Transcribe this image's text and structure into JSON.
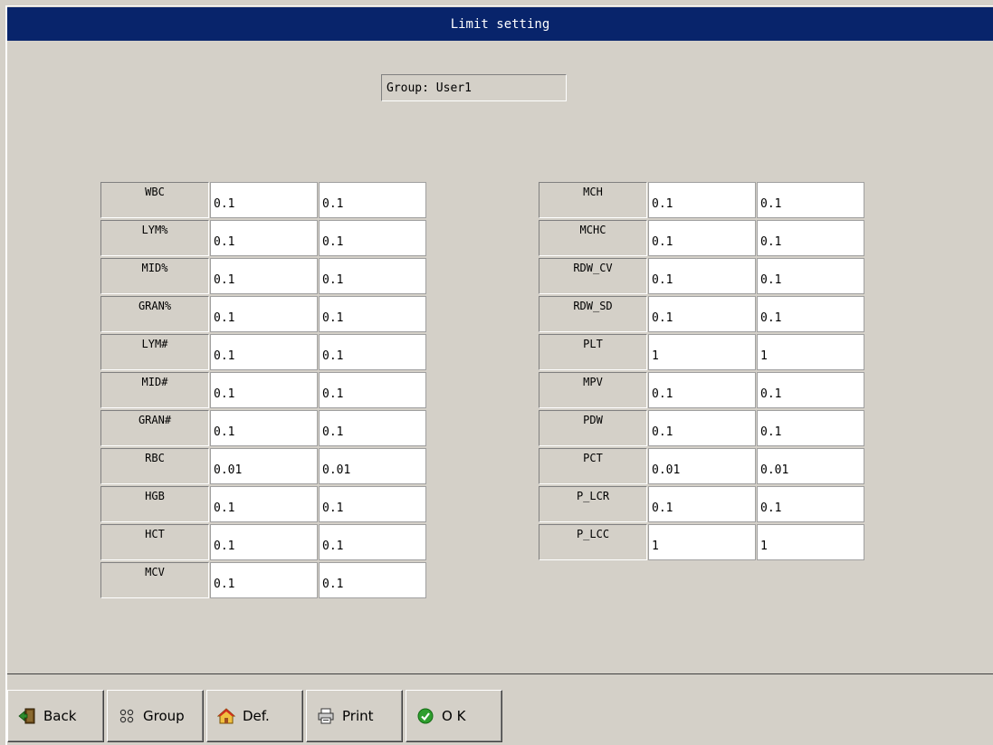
{
  "window": {
    "title": "Limit setting"
  },
  "group": {
    "text": "Group: User1"
  },
  "left_rows": [
    {
      "label": "WBC",
      "v1": "0.1",
      "v2": "0.1"
    },
    {
      "label": "LYM%",
      "v1": "0.1",
      "v2": "0.1"
    },
    {
      "label": "MID%",
      "v1": "0.1",
      "v2": "0.1"
    },
    {
      "label": "GRAN%",
      "v1": "0.1",
      "v2": "0.1"
    },
    {
      "label": "LYM#",
      "v1": "0.1",
      "v2": "0.1"
    },
    {
      "label": "MID#",
      "v1": "0.1",
      "v2": "0.1"
    },
    {
      "label": "GRAN#",
      "v1": "0.1",
      "v2": "0.1"
    },
    {
      "label": "RBC",
      "v1": "0.01",
      "v2": "0.01"
    },
    {
      "label": "HGB",
      "v1": "0.1",
      "v2": "0.1"
    },
    {
      "label": "HCT",
      "v1": "0.1",
      "v2": "0.1"
    },
    {
      "label": "MCV",
      "v1": "0.1",
      "v2": "0.1"
    }
  ],
  "right_rows": [
    {
      "label": "MCH",
      "v1": "0.1",
      "v2": "0.1"
    },
    {
      "label": "MCHC",
      "v1": "0.1",
      "v2": "0.1"
    },
    {
      "label": "RDW_CV",
      "v1": "0.1",
      "v2": "0.1"
    },
    {
      "label": "RDW_SD",
      "v1": "0.1",
      "v2": "0.1"
    },
    {
      "label": "PLT",
      "v1": "1",
      "v2": "1"
    },
    {
      "label": "MPV",
      "v1": "0.1",
      "v2": "0.1"
    },
    {
      "label": "PDW",
      "v1": "0.1",
      "v2": "0.1"
    },
    {
      "label": "PCT",
      "v1": "0.01",
      "v2": "0.01"
    },
    {
      "label": "P_LCR",
      "v1": "0.1",
      "v2": "0.1"
    },
    {
      "label": "P_LCC",
      "v1": "1",
      "v2": "1"
    }
  ],
  "toolbar": {
    "back_label": "Back",
    "back_icon": "exit-door-icon",
    "group_label": "Group",
    "group_icon": "grid-dots-icon",
    "def_label": "Def.",
    "def_icon": "home-icon",
    "print_label": "Print",
    "print_icon": "printer-icon",
    "ok_label": "O K",
    "ok_icon": "check-circle-icon"
  },
  "colors": {
    "titlebar": "#08246b",
    "background": "#d4d0c8",
    "ok_green": "#2e9e2e"
  }
}
